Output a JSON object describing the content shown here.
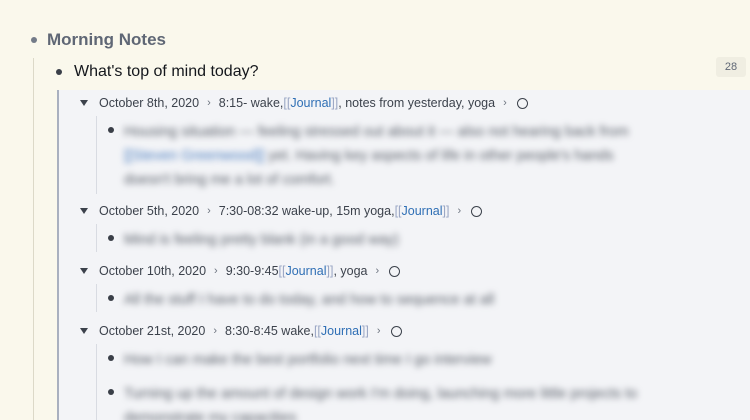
{
  "root": {
    "title": "Morning Notes"
  },
  "level2": {
    "title": "What's top of mind today?",
    "count": "28"
  },
  "entries": [
    {
      "date": "October 8th, 2020",
      "text_before": "8:15- wake, ",
      "open": "[[",
      "ref": "Journal",
      "close": "]]",
      "text_after": ", notes from yesterday, yoga",
      "child": {
        "line1": "Housing situation — feeling stressed out about it — also not hearing back from",
        "link": "[[Steven Greenwood]]",
        "line2_rest": " yet. Having key aspects of life in other people's hands",
        "line3": "doesn't bring me a lot of comfort."
      }
    },
    {
      "date": "October 5th, 2020",
      "text_before": "7:30-08:32 wake-up, 15m yoga, ",
      "open": "[[",
      "ref": "Journal",
      "close": "]]",
      "text_after": "",
      "child": {
        "line1": "Mind is feeling pretty blank (in a good way)"
      }
    },
    {
      "date": "October 10th, 2020",
      "text_before": "9:30-9:45 ",
      "open": "[[",
      "ref": "Journal",
      "close": "]]",
      "text_after": ", yoga",
      "child": {
        "line1": "All the stuff I have to do today, and how to sequence at all"
      }
    },
    {
      "date": "October 21st, 2020",
      "text_before": "8:30-8:45 wake, ",
      "open": "[[",
      "ref": "Journal",
      "close": "]]",
      "text_after": "",
      "children": [
        {
          "line1": "How I can make the best portfolio next time I go interview"
        },
        {
          "line1": "Turning up the amount of design work I'm doing, launching more little projects to",
          "line2": "demonstrate my capacities"
        }
      ]
    }
  ]
}
